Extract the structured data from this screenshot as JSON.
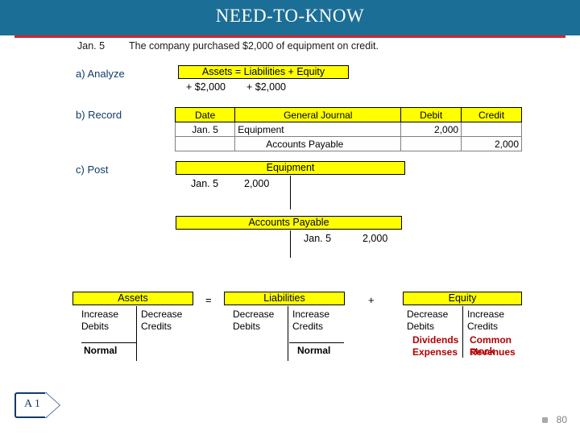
{
  "header": {
    "title": "NEED-TO-KNOW"
  },
  "intro": {
    "date": "Jan. 5",
    "text": "The company purchased $2,000 of equipment on credit."
  },
  "steps": {
    "analyze": "a) Analyze",
    "record": "b) Record",
    "post": "c)  Post"
  },
  "equation": {
    "header": "Assets =  Liabilities + Equity",
    "assets_change": "+ $2,000",
    "liabilities_change": "+ $2,000"
  },
  "journal": {
    "headers": [
      "Date",
      "General Journal",
      "Debit",
      "Credit"
    ],
    "rows": [
      {
        "date": "Jan. 5",
        "account": "Equipment",
        "indent": false,
        "debit": "2,000",
        "credit": ""
      },
      {
        "date": "",
        "account": "Accounts Payable",
        "indent": true,
        "debit": "",
        "credit": "2,000"
      },
      {
        "date": "",
        "account": "",
        "indent": false,
        "debit": "",
        "credit": ""
      }
    ]
  },
  "t_accounts": [
    {
      "title": "Equipment",
      "entry_date": "Jan. 5",
      "entry_amount": "2,000",
      "side": "debit"
    },
    {
      "title": "Accounts Payable",
      "entry_date": "Jan. 5",
      "entry_amount": "2,000",
      "side": "credit"
    }
  ],
  "rules": {
    "assets": {
      "title": "Assets",
      "left_line1": "Increase",
      "left_line2": "Debits",
      "right_line1": "Decrease",
      "right_line2": "Credits",
      "normal": "Normal"
    },
    "liabilities": {
      "title": "Liabilities",
      "left_line1": "Decrease",
      "left_line2": "Debits",
      "right_line1": "Increase",
      "right_line2": "Credits",
      "normal": "Normal"
    },
    "equity": {
      "title": "Equity",
      "left_line1": "Decrease",
      "left_line2": "Debits",
      "right_line1": "Increase",
      "right_line2": "Credits",
      "left_bold1": "Dividends",
      "left_bold2": "Expenses",
      "right_bold1": "Common stock",
      "right_bold2": "Revenues"
    },
    "operators": {
      "equals": "=",
      "plus": "+"
    }
  },
  "footer": {
    "objective_tag": "A 1",
    "page_number": "80"
  },
  "colors": {
    "header_bg": "#1b6e96",
    "header_rule": "#d8232a",
    "highlight": "#ffff00",
    "step_label": "#113b6b",
    "bold_red": "#b00000"
  }
}
